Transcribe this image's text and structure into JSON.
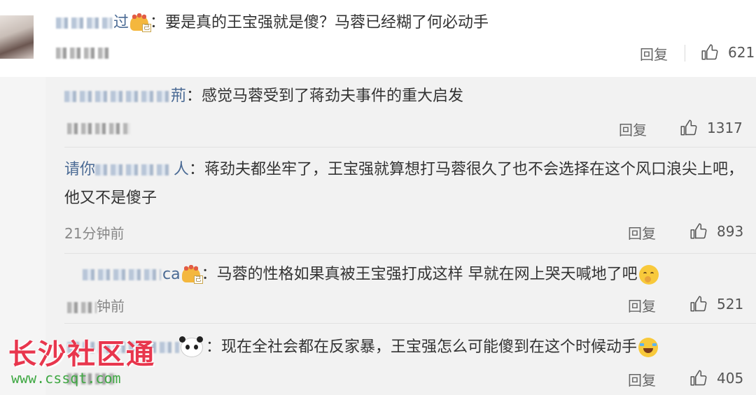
{
  "comments": [
    {
      "text": "要是真的王宝强就是傻？马蓉已经糊了何必动手",
      "name_visible": "过",
      "likes": "621",
      "reply_label": "回复"
    },
    {
      "text": "感觉马蓉受到了蒋劲夫事件的重大启发",
      "name_visible": "荊",
      "likes": "1317",
      "reply_label": "回复"
    },
    {
      "text": "蒋劲夫都坐牢了，王宝强就算想打马蓉很久了也不会选择在这个风口浪尖上吧，他又不是傻子",
      "name_prefix": "请你",
      "name_visible": "人",
      "time": "21分钟前",
      "likes": "893",
      "reply_label": "回复"
    },
    {
      "text": "马蓉的性格如果真被王宝强打成这样 早就在网上哭天喊地了吧",
      "name_visible": "ca",
      "time_visible": "钟前",
      "likes": "521",
      "reply_label": "回复"
    },
    {
      "text": "现在全社会都在反家暴，王宝强怎么可能傻到在这个时候动手",
      "likes": "405",
      "reply_label": "回复"
    }
  ],
  "watermark": {
    "title": "长沙社区通",
    "url": "www.cssqt.com"
  },
  "colors": {
    "name_blue": "#4a6a94",
    "watermark_red": "#e8364d",
    "watermark_green": "#3fa843"
  }
}
